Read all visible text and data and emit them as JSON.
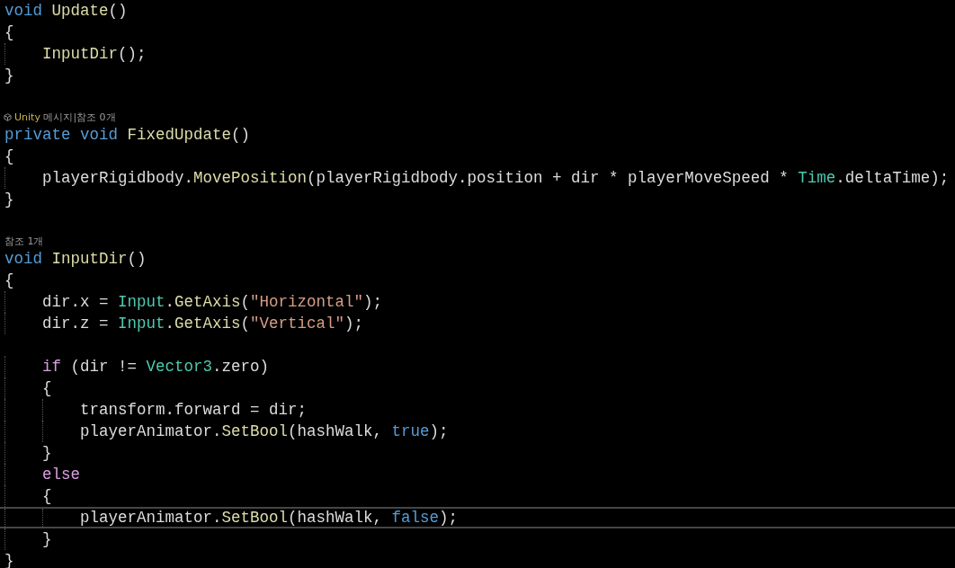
{
  "editor": {
    "lines": [
      {
        "kind": "code",
        "current": false,
        "tokens": [
          {
            "text": "void ",
            "kind": "keyword"
          },
          {
            "text": "Update",
            "kind": "method"
          },
          {
            "text": "()",
            "kind": "plain"
          }
        ]
      },
      {
        "kind": "code",
        "current": false,
        "tokens": [
          {
            "text": "{",
            "kind": "plain"
          }
        ]
      },
      {
        "kind": "code",
        "current": false,
        "tokens": [
          {
            "text": "    InputDir",
            "kind": "method"
          },
          {
            "text": "();",
            "kind": "plain"
          }
        ]
      },
      {
        "kind": "code",
        "current": false,
        "tokens": [
          {
            "text": "}",
            "kind": "plain"
          }
        ]
      },
      {
        "kind": "blank",
        "current": false
      },
      {
        "kind": "lens",
        "current": false,
        "tokens": [
          {
            "text": "Unity",
            "kind": "lens-link"
          },
          {
            "text": " 메시지",
            "kind": "lens"
          },
          {
            "text": "|",
            "kind": "lens"
          },
          {
            "text": "참조 0개",
            "kind": "lens"
          }
        ]
      },
      {
        "kind": "code",
        "current": false,
        "tokens": [
          {
            "text": "private void ",
            "kind": "keyword"
          },
          {
            "text": "FixedUpdate",
            "kind": "method"
          },
          {
            "text": "()",
            "kind": "plain"
          }
        ]
      },
      {
        "kind": "code",
        "current": false,
        "tokens": [
          {
            "text": "{",
            "kind": "plain"
          }
        ]
      },
      {
        "kind": "code",
        "current": false,
        "tokens": [
          {
            "text": "    playerRigidbody.",
            "kind": "plain"
          },
          {
            "text": "MovePosition",
            "kind": "method"
          },
          {
            "text": "(playerRigidbody.position + dir * playerMoveSpeed * ",
            "kind": "plain"
          },
          {
            "text": "Time",
            "kind": "type"
          },
          {
            "text": ".deltaTime);",
            "kind": "plain"
          }
        ]
      },
      {
        "kind": "code",
        "current": false,
        "tokens": [
          {
            "text": "}",
            "kind": "plain"
          }
        ]
      },
      {
        "kind": "blank",
        "current": false
      },
      {
        "kind": "lens",
        "current": false,
        "tokens": [
          {
            "text": "참조 1개",
            "kind": "lens"
          }
        ]
      },
      {
        "kind": "code",
        "current": false,
        "tokens": [
          {
            "text": "void ",
            "kind": "keyword"
          },
          {
            "text": "InputDir",
            "kind": "method"
          },
          {
            "text": "()",
            "kind": "plain"
          }
        ]
      },
      {
        "kind": "code",
        "current": false,
        "tokens": [
          {
            "text": "{",
            "kind": "plain"
          }
        ]
      },
      {
        "kind": "code",
        "current": false,
        "tokens": [
          {
            "text": "    dir.x = ",
            "kind": "plain"
          },
          {
            "text": "Input",
            "kind": "type"
          },
          {
            "text": ".",
            "kind": "plain"
          },
          {
            "text": "GetAxis",
            "kind": "method"
          },
          {
            "text": "(",
            "kind": "plain"
          },
          {
            "text": "\"Horizontal\"",
            "kind": "string"
          },
          {
            "text": ");",
            "kind": "plain"
          }
        ]
      },
      {
        "kind": "code",
        "current": false,
        "tokens": [
          {
            "text": "    dir.z = ",
            "kind": "plain"
          },
          {
            "text": "Input",
            "kind": "type"
          },
          {
            "text": ".",
            "kind": "plain"
          },
          {
            "text": "GetAxis",
            "kind": "method"
          },
          {
            "text": "(",
            "kind": "plain"
          },
          {
            "text": "\"Vertical\"",
            "kind": "string"
          },
          {
            "text": ");",
            "kind": "plain"
          }
        ]
      },
      {
        "kind": "blank",
        "current": false
      },
      {
        "kind": "code",
        "current": false,
        "tokens": [
          {
            "text": "    if",
            "kind": "control"
          },
          {
            "text": " (dir != ",
            "kind": "plain"
          },
          {
            "text": "Vector3",
            "kind": "type"
          },
          {
            "text": ".zero)",
            "kind": "plain"
          }
        ]
      },
      {
        "kind": "code",
        "current": false,
        "tokens": [
          {
            "text": "    {",
            "kind": "plain"
          }
        ]
      },
      {
        "kind": "code",
        "current": false,
        "tokens": [
          {
            "text": "        transform.forward = dir;",
            "kind": "plain"
          }
        ]
      },
      {
        "kind": "code",
        "current": false,
        "tokens": [
          {
            "text": "        playerAnimator.",
            "kind": "plain"
          },
          {
            "text": "SetBool",
            "kind": "method"
          },
          {
            "text": "(hashWalk, ",
            "kind": "plain"
          },
          {
            "text": "true",
            "kind": "keyword"
          },
          {
            "text": ");",
            "kind": "plain"
          }
        ]
      },
      {
        "kind": "code",
        "current": false,
        "tokens": [
          {
            "text": "    }",
            "kind": "plain"
          }
        ]
      },
      {
        "kind": "code",
        "current": false,
        "tokens": [
          {
            "text": "    else",
            "kind": "control"
          }
        ]
      },
      {
        "kind": "code",
        "current": false,
        "tokens": [
          {
            "text": "    {",
            "kind": "plain"
          }
        ]
      },
      {
        "kind": "code",
        "current": true,
        "tokens": [
          {
            "text": "        playerAnimator.",
            "kind": "plain"
          },
          {
            "text": "SetBool",
            "kind": "method"
          },
          {
            "text": "(hashWalk, ",
            "kind": "plain"
          },
          {
            "text": "false",
            "kind": "keyword"
          },
          {
            "text": ");",
            "kind": "plain"
          }
        ]
      },
      {
        "kind": "code",
        "current": false,
        "tokens": [
          {
            "text": "    }",
            "kind": "plain"
          }
        ]
      },
      {
        "kind": "code",
        "current": false,
        "tokens": [
          {
            "text": "}",
            "kind": "plain"
          }
        ]
      }
    ]
  }
}
